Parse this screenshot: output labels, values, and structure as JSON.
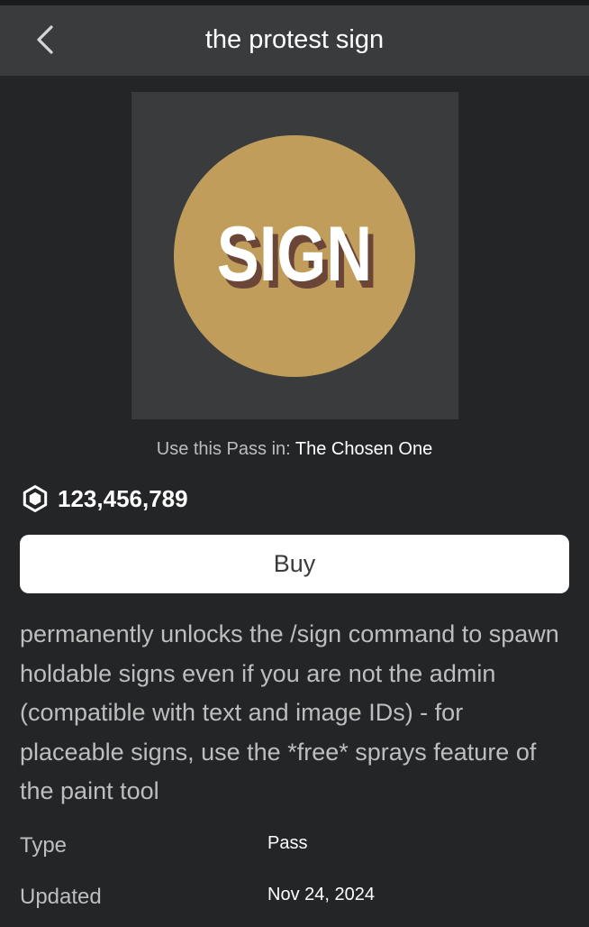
{
  "header": {
    "title": "the protest sign",
    "back_icon": "chevron-left-icon"
  },
  "thumbnail": {
    "text": "SIGN",
    "circle_color": "#c09d5b",
    "text_color": "#ffffff",
    "shadow_color": "#6b4638",
    "background_color": "#393b3d"
  },
  "use_in": {
    "label": "Use this Pass in:",
    "game_name": "The Chosen One"
  },
  "price": {
    "icon": "robux-icon",
    "value": "123,456,789"
  },
  "buy_button": {
    "label": "Buy"
  },
  "description": "permanently unlocks the /sign command to spawn holdable signs even if you are not the admin (compatible with text and image IDs) - for placeable signs, use the *free* sprays feature of the paint tool",
  "details": [
    {
      "label": "Type",
      "value": "Pass"
    },
    {
      "label": "Updated",
      "value": "Nov 24, 2024"
    }
  ]
}
